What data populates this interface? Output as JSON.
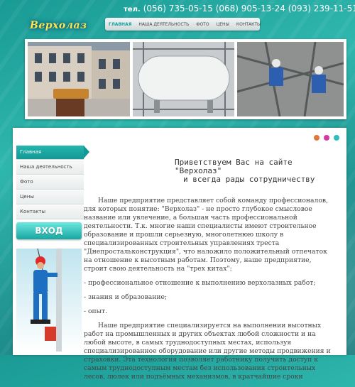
{
  "header": {
    "logo_text": "Верхолаз",
    "phone_label": "тел.",
    "phones": "(056) 735-05-15 (068) 905-13-24 (093) 239-11-51"
  },
  "nav": [
    {
      "label": "ГЛАВНАЯ",
      "active": true
    },
    {
      "label": "НАША ДЕЯТЕЛЬНОСТЬ",
      "active": false
    },
    {
      "label": "ФОТО",
      "active": false
    },
    {
      "label": "ЦЕНЫ",
      "active": false
    },
    {
      "label": "КОНТАКТЫ",
      "active": false
    }
  ],
  "sidebar": [
    {
      "label": "Главная",
      "active": true
    },
    {
      "label": "Наша деятельность",
      "active": false
    },
    {
      "label": "Фото",
      "active": false
    },
    {
      "label": "Цены",
      "active": false
    },
    {
      "label": "Контакты",
      "active": false
    }
  ],
  "enter_button": "ВХОД",
  "slider_dots": [
    "#e0763a",
    "#d23aa0",
    "#2fbdb7"
  ],
  "welcome": {
    "line1": "Приветствуем Вас на сайте \"Верхолаз\"",
    "line2": "и всегда рады сотрудничеству"
  },
  "content": {
    "p1": "Наше предприятие представляет собой команду профессионалов, для которых понятие: \"Верхолаз\" - не просто глубокое смысловое название или увлечение, а большая часть профессиональной деятельности. Т.к. многие наши специалисты имеют строительное образование и прошли серьезную, многолетнюю школу в специализированных строительных управлениях треста \"Днепростальконструкция\", что наложило положительный отпечаток на отношение к высотным работам. Поэтому, наше предприятие, строит свою деятельность на \"трех китах\":",
    "list": [
      "- профессиональное отношение к выполнению верхолазных работ;",
      "- знания и образование;",
      "- опыт."
    ],
    "p2": "Наше предприятие специализируется на выполнении высотных работ на промышленных и других объектах любой сложности и на любой высоте, в самых труднодоступных местах, используя специализированное оборудование или другие методы продвижения и страховки. Эта технология позволяет работнику получить доступ к самым труднодоступным местам без использования строительных лесов, люлек или подъёмных механизмов, в кратчайшие сроки"
  }
}
